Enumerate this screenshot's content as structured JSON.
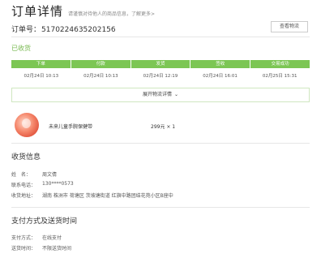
{
  "header": {
    "title": "订单详情",
    "subtitle": "请谨慎对待他人的商品信息，了解更多>"
  },
  "order": {
    "number_label": "订单号：",
    "number": "5170224635202156",
    "detail_button": "查看物流"
  },
  "status": "已收货",
  "progress": {
    "steps": [
      {
        "label": "下单",
        "time": "02月24日 10:13"
      },
      {
        "label": "付款",
        "time": "02月24日 10:13"
      },
      {
        "label": "发货",
        "time": "02月24日 12:19"
      },
      {
        "label": "签收",
        "time": "02月24日 16:01"
      },
      {
        "label": "交易成功",
        "time": "02月25日 15:31"
      }
    ],
    "expand_label": "展开物流详情"
  },
  "product": {
    "name": "未来儿童手腕保健带",
    "price": "299元 × 1",
    "image_icon": "product-thumbnail"
  },
  "receiver": {
    "title": "收货信息",
    "rows": [
      {
        "key": "姓　名：",
        "value": "周文倩"
      },
      {
        "key": "联系电话：",
        "value": "130****0573"
      },
      {
        "key": "收货地址：",
        "value": "湖南 株洲市 荷塘区 茨坡塘街道 红旗中路团结花苑小区B座中"
      }
    ]
  },
  "payment": {
    "title": "支付方式及送货时间",
    "rows": [
      {
        "key": "支付方式：",
        "value": "在线支付"
      },
      {
        "key": "送货时间：",
        "value": "不限送货时间"
      }
    ]
  },
  "colors": {
    "accent_green": "#7cc654",
    "status_green": "#77b84f"
  }
}
